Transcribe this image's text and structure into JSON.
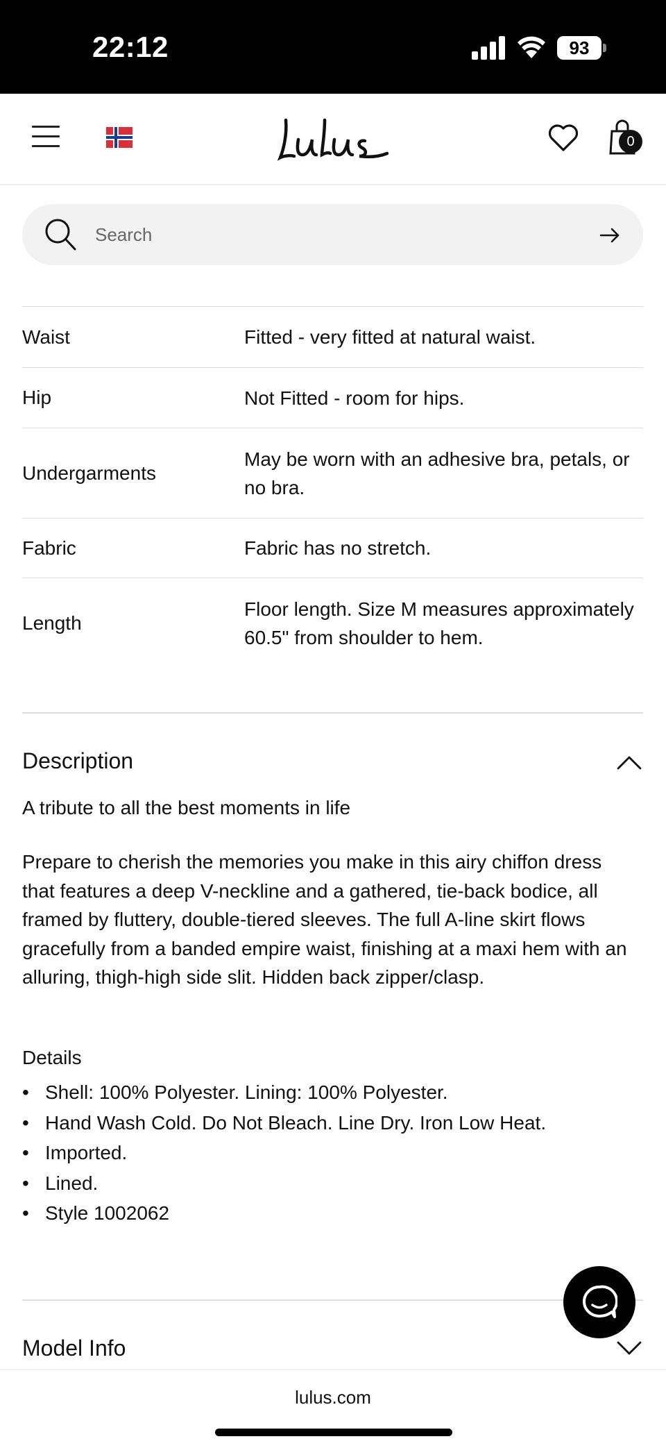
{
  "status_bar": {
    "time": "22:12",
    "battery": "93",
    "icons": [
      "signal-icon",
      "wifi-icon",
      "battery-icon"
    ]
  },
  "header": {
    "logo": "Lulus",
    "cart_count": "0",
    "icons": [
      "menu-icon",
      "norway-flag-icon",
      "heart-icon",
      "shopping-bag-icon"
    ]
  },
  "search": {
    "placeholder": "Search"
  },
  "fit_table": {
    "rows": [
      {
        "label": "Waist",
        "value": "Fitted - very fitted at natural waist."
      },
      {
        "label": "Hip",
        "value": "Not Fitted - room for hips."
      },
      {
        "label": "Undergarments",
        "value": "May be worn with an adhesive bra, petals, or no bra."
      },
      {
        "label": "Fabric",
        "value": "Fabric has no stretch."
      },
      {
        "label": "Length",
        "value": "Floor length. Size M measures approximately 60.5\" from shoulder to hem."
      }
    ]
  },
  "description": {
    "title": "Description",
    "tagline": "A tribute to all the best moments in life",
    "body": "Prepare to cherish the memories you make in this airy chiffon dress that features a deep V-neckline and a gathered, tie-back bodice, all framed by fluttery, double-tiered sleeves. The full A-line skirt flows gracefully from a banded empire waist, finishing at a maxi hem with an alluring, thigh-high side slit. Hidden back zipper/clasp.",
    "details_title": "Details",
    "details": [
      "Shell: 100% Polyester. Lining: 100% Polyester.",
      "Hand Wash Cold. Do Not Bleach. Line Dry. Iron Low Heat.",
      "Imported.",
      "Lined.",
      "Style 1002062"
    ]
  },
  "model_info": {
    "title": "Model Info"
  },
  "browser": {
    "url": "lulus.com"
  },
  "colors": {
    "accent": "#000000",
    "divider": "#dddddd",
    "search_bg": "#f2f2f2"
  }
}
